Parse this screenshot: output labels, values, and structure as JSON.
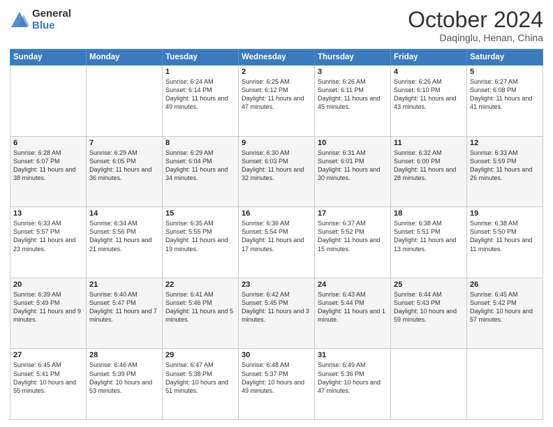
{
  "logo": {
    "general": "General",
    "blue": "Blue"
  },
  "header": {
    "month": "October 2024",
    "location": "Daqinglu, Henan, China"
  },
  "days_of_week": [
    "Sunday",
    "Monday",
    "Tuesday",
    "Wednesday",
    "Thursday",
    "Friday",
    "Saturday"
  ],
  "weeks": [
    [
      {
        "day": "",
        "info": ""
      },
      {
        "day": "",
        "info": ""
      },
      {
        "day": "1",
        "info": "Sunrise: 6:24 AM\nSunset: 6:14 PM\nDaylight: 11 hours and 49 minutes."
      },
      {
        "day": "2",
        "info": "Sunrise: 6:25 AM\nSunset: 6:12 PM\nDaylight: 11 hours and 47 minutes."
      },
      {
        "day": "3",
        "info": "Sunrise: 6:26 AM\nSunset: 6:11 PM\nDaylight: 11 hours and 45 minutes."
      },
      {
        "day": "4",
        "info": "Sunrise: 6:26 AM\nSunset: 6:10 PM\nDaylight: 11 hours and 43 minutes."
      },
      {
        "day": "5",
        "info": "Sunrise: 6:27 AM\nSunset: 6:08 PM\nDaylight: 11 hours and 41 minutes."
      }
    ],
    [
      {
        "day": "6",
        "info": "Sunrise: 6:28 AM\nSunset: 6:07 PM\nDaylight: 11 hours and 38 minutes."
      },
      {
        "day": "7",
        "info": "Sunrise: 6:29 AM\nSunset: 6:05 PM\nDaylight: 11 hours and 36 minutes."
      },
      {
        "day": "8",
        "info": "Sunrise: 6:29 AM\nSunset: 6:04 PM\nDaylight: 11 hours and 34 minutes."
      },
      {
        "day": "9",
        "info": "Sunrise: 6:30 AM\nSunset: 6:03 PM\nDaylight: 11 hours and 32 minutes."
      },
      {
        "day": "10",
        "info": "Sunrise: 6:31 AM\nSunset: 6:01 PM\nDaylight: 11 hours and 30 minutes."
      },
      {
        "day": "11",
        "info": "Sunrise: 6:32 AM\nSunset: 6:00 PM\nDaylight: 11 hours and 28 minutes."
      },
      {
        "day": "12",
        "info": "Sunrise: 6:33 AM\nSunset: 5:59 PM\nDaylight: 11 hours and 26 minutes."
      }
    ],
    [
      {
        "day": "13",
        "info": "Sunrise: 6:33 AM\nSunset: 5:57 PM\nDaylight: 11 hours and 23 minutes."
      },
      {
        "day": "14",
        "info": "Sunrise: 6:34 AM\nSunset: 5:56 PM\nDaylight: 11 hours and 21 minutes."
      },
      {
        "day": "15",
        "info": "Sunrise: 6:35 AM\nSunset: 5:55 PM\nDaylight: 11 hours and 19 minutes."
      },
      {
        "day": "16",
        "info": "Sunrise: 6:36 AM\nSunset: 5:54 PM\nDaylight: 11 hours and 17 minutes."
      },
      {
        "day": "17",
        "info": "Sunrise: 6:37 AM\nSunset: 5:52 PM\nDaylight: 11 hours and 15 minutes."
      },
      {
        "day": "18",
        "info": "Sunrise: 6:38 AM\nSunset: 5:51 PM\nDaylight: 11 hours and 13 minutes."
      },
      {
        "day": "19",
        "info": "Sunrise: 6:38 AM\nSunset: 5:50 PM\nDaylight: 11 hours and 11 minutes."
      }
    ],
    [
      {
        "day": "20",
        "info": "Sunrise: 6:39 AM\nSunset: 5:49 PM\nDaylight: 11 hours and 9 minutes."
      },
      {
        "day": "21",
        "info": "Sunrise: 6:40 AM\nSunset: 5:47 PM\nDaylight: 11 hours and 7 minutes."
      },
      {
        "day": "22",
        "info": "Sunrise: 6:41 AM\nSunset: 5:46 PM\nDaylight: 11 hours and 5 minutes."
      },
      {
        "day": "23",
        "info": "Sunrise: 6:42 AM\nSunset: 5:45 PM\nDaylight: 11 hours and 3 minutes."
      },
      {
        "day": "24",
        "info": "Sunrise: 6:43 AM\nSunset: 5:44 PM\nDaylight: 11 hours and 1 minute."
      },
      {
        "day": "25",
        "info": "Sunrise: 6:44 AM\nSunset: 5:43 PM\nDaylight: 10 hours and 59 minutes."
      },
      {
        "day": "26",
        "info": "Sunrise: 6:45 AM\nSunset: 5:42 PM\nDaylight: 10 hours and 57 minutes."
      }
    ],
    [
      {
        "day": "27",
        "info": "Sunrise: 6:45 AM\nSunset: 5:41 PM\nDaylight: 10 hours and 55 minutes."
      },
      {
        "day": "28",
        "info": "Sunrise: 6:46 AM\nSunset: 5:39 PM\nDaylight: 10 hours and 53 minutes."
      },
      {
        "day": "29",
        "info": "Sunrise: 6:47 AM\nSunset: 5:38 PM\nDaylight: 10 hours and 51 minutes."
      },
      {
        "day": "30",
        "info": "Sunrise: 6:48 AM\nSunset: 5:37 PM\nDaylight: 10 hours and 49 minutes."
      },
      {
        "day": "31",
        "info": "Sunrise: 6:49 AM\nSunset: 5:36 PM\nDaylight: 10 hours and 47 minutes."
      },
      {
        "day": "",
        "info": ""
      },
      {
        "day": "",
        "info": ""
      }
    ]
  ]
}
